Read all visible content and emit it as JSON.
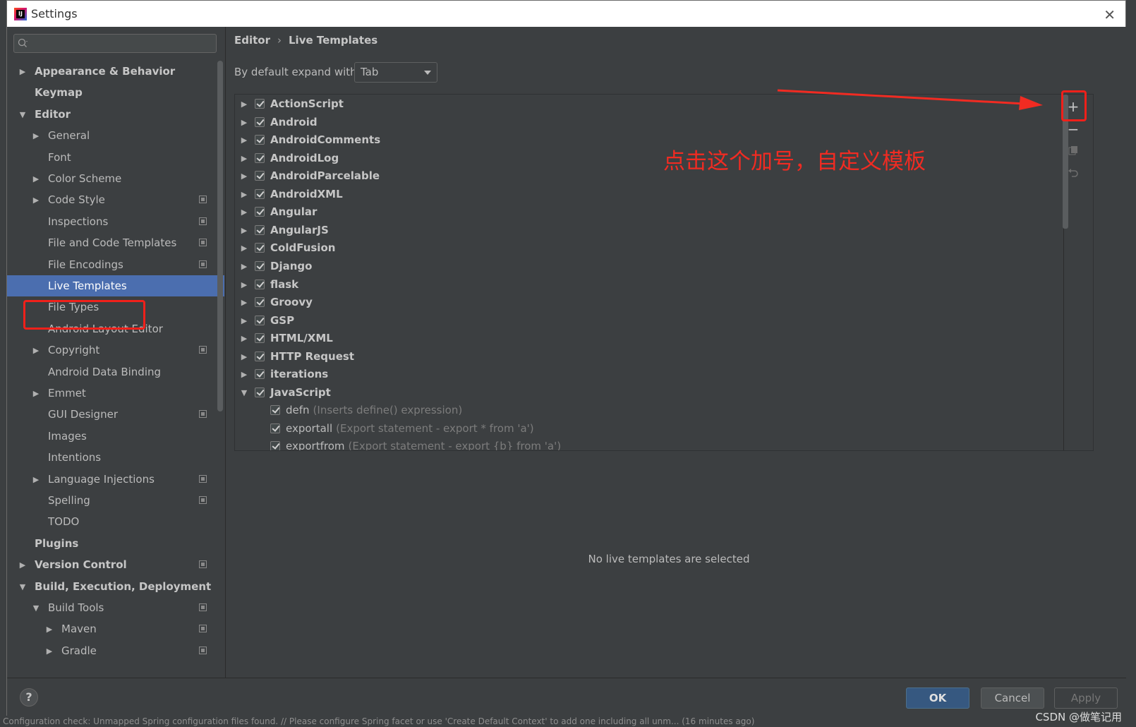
{
  "window": {
    "title": "Settings"
  },
  "search": {
    "placeholder": ""
  },
  "sidebar": {
    "items": [
      {
        "label": "Appearance & Behavior",
        "bold": true,
        "level": 0,
        "arrow": "right",
        "copy": false
      },
      {
        "label": "Keymap",
        "bold": true,
        "level": 0,
        "arrow": "",
        "copy": false
      },
      {
        "label": "Editor",
        "bold": true,
        "level": 0,
        "arrow": "down",
        "copy": false
      },
      {
        "label": "General",
        "bold": false,
        "level": 1,
        "arrow": "right",
        "copy": false
      },
      {
        "label": "Font",
        "bold": false,
        "level": 1,
        "arrow": "",
        "copy": false
      },
      {
        "label": "Color Scheme",
        "bold": false,
        "level": 1,
        "arrow": "right",
        "copy": false
      },
      {
        "label": "Code Style",
        "bold": false,
        "level": 1,
        "arrow": "right",
        "copy": true
      },
      {
        "label": "Inspections",
        "bold": false,
        "level": 1,
        "arrow": "",
        "copy": true
      },
      {
        "label": "File and Code Templates",
        "bold": false,
        "level": 1,
        "arrow": "",
        "copy": true
      },
      {
        "label": "File Encodings",
        "bold": false,
        "level": 1,
        "arrow": "",
        "copy": true
      },
      {
        "label": "Live Templates",
        "bold": false,
        "level": 1,
        "arrow": "",
        "copy": false,
        "selected": true
      },
      {
        "label": "File Types",
        "bold": false,
        "level": 1,
        "arrow": "",
        "copy": false
      },
      {
        "label": "Android Layout Editor",
        "bold": false,
        "level": 1,
        "arrow": "",
        "copy": false
      },
      {
        "label": "Copyright",
        "bold": false,
        "level": 1,
        "arrow": "right",
        "copy": true
      },
      {
        "label": "Android Data Binding",
        "bold": false,
        "level": 1,
        "arrow": "",
        "copy": false
      },
      {
        "label": "Emmet",
        "bold": false,
        "level": 1,
        "arrow": "right",
        "copy": false
      },
      {
        "label": "GUI Designer",
        "bold": false,
        "level": 1,
        "arrow": "",
        "copy": true
      },
      {
        "label": "Images",
        "bold": false,
        "level": 1,
        "arrow": "",
        "copy": false
      },
      {
        "label": "Intentions",
        "bold": false,
        "level": 1,
        "arrow": "",
        "copy": false
      },
      {
        "label": "Language Injections",
        "bold": false,
        "level": 1,
        "arrow": "right",
        "copy": true
      },
      {
        "label": "Spelling",
        "bold": false,
        "level": 1,
        "arrow": "",
        "copy": true
      },
      {
        "label": "TODO",
        "bold": false,
        "level": 1,
        "arrow": "",
        "copy": false
      },
      {
        "label": "Plugins",
        "bold": true,
        "level": 0,
        "arrow": "",
        "copy": false
      },
      {
        "label": "Version Control",
        "bold": true,
        "level": 0,
        "arrow": "right",
        "copy": true
      },
      {
        "label": "Build, Execution, Deployment",
        "bold": true,
        "level": 0,
        "arrow": "down",
        "copy": false
      },
      {
        "label": "Build Tools",
        "bold": false,
        "level": 1,
        "arrow": "down",
        "copy": true
      },
      {
        "label": "Maven",
        "bold": false,
        "level": 2,
        "arrow": "right",
        "copy": true
      },
      {
        "label": "Gradle",
        "bold": false,
        "level": 2,
        "arrow": "right",
        "copy": true
      }
    ]
  },
  "breadcrumb": {
    "parent": "Editor",
    "separator": "›",
    "current": "Live Templates"
  },
  "expand": {
    "label": "By default expand with",
    "value": "Tab"
  },
  "templates": {
    "groups": [
      {
        "name": "ActionScript",
        "checked": true,
        "expanded": false
      },
      {
        "name": "Android",
        "checked": true,
        "expanded": false
      },
      {
        "name": "AndroidComments",
        "checked": true,
        "expanded": false
      },
      {
        "name": "AndroidLog",
        "checked": true,
        "expanded": false
      },
      {
        "name": "AndroidParcelable",
        "checked": true,
        "expanded": false
      },
      {
        "name": "AndroidXML",
        "checked": true,
        "expanded": false
      },
      {
        "name": "Angular",
        "checked": true,
        "expanded": false
      },
      {
        "name": "AngularJS",
        "checked": true,
        "expanded": false
      },
      {
        "name": "ColdFusion",
        "checked": true,
        "expanded": false
      },
      {
        "name": "Django",
        "checked": true,
        "expanded": false
      },
      {
        "name": "flask",
        "checked": true,
        "expanded": false
      },
      {
        "name": "Groovy",
        "checked": true,
        "expanded": false
      },
      {
        "name": "GSP",
        "checked": true,
        "expanded": false
      },
      {
        "name": "HTML/XML",
        "checked": true,
        "expanded": false
      },
      {
        "name": "HTTP Request",
        "checked": true,
        "expanded": false
      },
      {
        "name": "iterations",
        "checked": true,
        "expanded": false
      },
      {
        "name": "JavaScript",
        "checked": true,
        "expanded": true
      }
    ],
    "js_items": [
      {
        "name": "defn",
        "desc": "(Inserts define() expression)",
        "checked": true
      },
      {
        "name": "exportall",
        "desc": "(Export statement - export * from 'a')",
        "checked": true
      },
      {
        "name": "exportfrom",
        "desc": "(Export statement - export {b} from 'a')",
        "checked": true
      }
    ]
  },
  "tools": {
    "add": "+",
    "remove": "−"
  },
  "annotation": {
    "text": "点击这个加号，自定义模板"
  },
  "empty_message": "No live templates are selected",
  "footer": {
    "help": "?",
    "ok": "OK",
    "cancel": "Cancel",
    "apply": "Apply"
  },
  "background": {
    "status_text": "Configuration check: Unmapped Spring configuration files found. // Please configure Spring facet or use 'Create Default Context' to add one including all unm... (16 minutes ago)",
    "watermark": "CSDN @做笔记用"
  },
  "colors": {
    "selection": "#4b6eaf",
    "annotation": "#f12b22",
    "panel": "#3c3f41"
  }
}
